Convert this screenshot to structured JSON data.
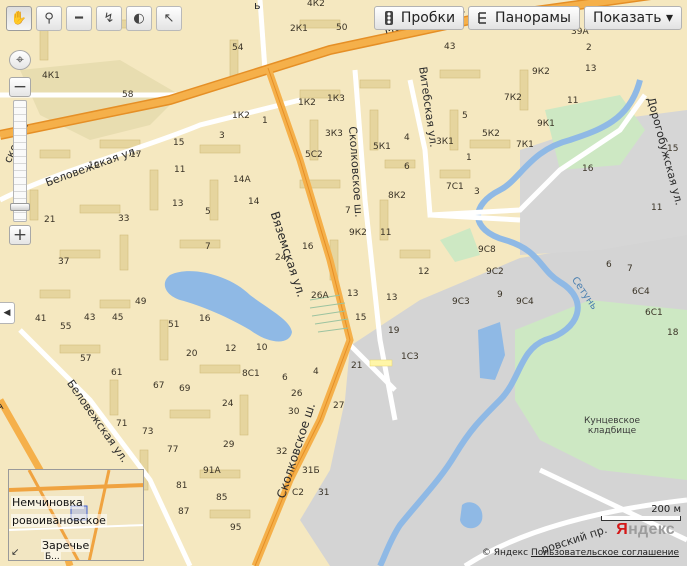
{
  "toolbar": {
    "tools": [
      {
        "name": "pan",
        "icon": "hand-icon"
      },
      {
        "name": "magnifier",
        "icon": "magnifier-icon"
      },
      {
        "name": "ruler",
        "icon": "ruler-icon"
      },
      {
        "name": "route",
        "icon": "route-icon"
      },
      {
        "name": "search-area",
        "icon": "globe-search-icon"
      },
      {
        "name": "select",
        "icon": "cursor-question-icon"
      }
    ]
  },
  "top_buttons": {
    "traffic": "Пробки",
    "panoramas": "Панорамы",
    "show": "Показать ▾"
  },
  "streets": {
    "vyazemskaya": "Вяземская ул.",
    "skolkovskoe_upper": "Сколковское ш.",
    "skolkovskoe_lower": "Сколковское ш.",
    "belovezhskaya_top": "Беловежская ул.",
    "belovezhskaya_bottom": "Беловежская ул.",
    "vitebskaya": "Витебская ул.",
    "dorogobuzhskaya": "Дорогобужская ул.",
    "mozhayskoe": "Можайское ш.",
    "partial_left_top": "ское ш.",
    "partial_left_bottom": "т",
    "partial_pr": "ровский пр.",
    "partial_top_left": "ь"
  },
  "river": {
    "name": "Сетунь"
  },
  "areas": {
    "cemetery": "Кунцевское\nкладбище"
  },
  "houses": {
    "h_4k2": "4К2",
    "h_2k1": "2К1",
    "h_50": "50",
    "h_54": "54",
    "h_4k1": "4К1",
    "h_58": "58",
    "h_1k2a": "1К2",
    "h_1k3": "1К3",
    "h_1k2b": "1К2",
    "h_3": "3",
    "h_1": "1",
    "h_3k3": "3К3",
    "h_5c2": "5С2",
    "h_17": "17",
    "h_15a": "15",
    "h_19a": "19",
    "h_11a": "11",
    "h_13a": "13",
    "h_14a": "14А",
    "h_14": "14",
    "h_5": "5",
    "h_7": "7",
    "h_21": "21",
    "h_33": "33",
    "h_37": "37",
    "h_16a": "16",
    "h_24": "24",
    "h_26a": "26А",
    "h_7b": "7",
    "h_9k2": "9К2",
    "h_13b": "13",
    "h_15b": "15",
    "h_5k1": "5К1",
    "h_4": "4",
    "h_6": "6",
    "h_8k2": "8К2",
    "h_11b": "11",
    "h_13c": "13",
    "h_12": "12",
    "h_19b": "19",
    "h_21b": "21",
    "h_1c3": "1С3",
    "h_49": "49",
    "h_41": "41",
    "h_55": "55",
    "h_43": "43",
    "h_45": "45",
    "h_51": "51",
    "h_16b": "16",
    "h_20": "20",
    "h_12b": "12",
    "h_10": "10",
    "h_57": "57",
    "h_61": "61",
    "h_67": "67",
    "h_69": "69",
    "h_8c1": "8С1",
    "h_6b": "6",
    "h_4b": "4",
    "h_71": "71",
    "h_73": "73",
    "h_24b": "24",
    "h_26": "26",
    "h_27": "27",
    "h_30": "30",
    "h_77": "77",
    "h_29": "29",
    "h_91a": "91А",
    "h_81": "81",
    "h_85": "85",
    "h_87": "87",
    "h_95": "95",
    "h_32": "32",
    "h_31b": "31Б",
    "h_c2": "С2",
    "h_31": "31",
    "h_43b": "43",
    "h_39a": "39А",
    "h_9k2b": "9К2",
    "h_13d": "13",
    "h_7k2": "7К2",
    "h_11c": "11",
    "h_3k1": "3К1",
    "h_5k2": "5К2",
    "h_9k1": "9К1",
    "h_7k1": "7К1",
    "h_1b": "1",
    "h_7c1": "7С1",
    "h_3b": "3",
    "h_5b": "5",
    "h_9c8": "9С8",
    "h_9c2": "9С2",
    "h_9": "9",
    "h_9c3": "9С3",
    "h_9c4": "9С4",
    "h_6c": "6",
    "h_7c": "7",
    "h_6c4": "6С4",
    "h_6c1": "6С1",
    "h_18": "18",
    "h_11d": "11",
    "h_15c": "15",
    "h_16c": "16",
    "h_2": "2",
    "h_4k2b": "4К2"
  },
  "minimap": {
    "label_nemchinovka": "Немчиновка",
    "label_novoivanovskoe": "ровоивановское",
    "label_zarechye": "Заречье",
    "label_bottom": "Б...",
    "corner_icon": "expand-corner-icon"
  },
  "scale": {
    "label": "200 м"
  },
  "logo": {
    "first_letter": "Я",
    "rest": "ндекс"
  },
  "copyright": {
    "owner": "© Яндекс",
    "agreement": "Пользовательское соглашение"
  },
  "colors": {
    "land": "#f5e8c0",
    "highway": "#f0a340",
    "industrial": "#d2d2d2",
    "green": "#cde8c3",
    "water": "#8fb9e5",
    "building": "#e6d59e"
  }
}
